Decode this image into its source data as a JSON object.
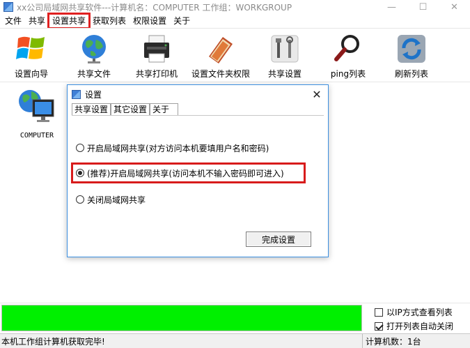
{
  "window": {
    "title": "xx公司局域网共享软件---计算机名：COMPUTER  工作组：WORKGROUP",
    "minimize": "—",
    "maximize": "☐",
    "close": "✕"
  },
  "menu": [
    {
      "label": "文件"
    },
    {
      "label": "共享"
    },
    {
      "label": "设置共享"
    },
    {
      "label": "获取列表"
    },
    {
      "label": "权限设置"
    },
    {
      "label": "关于"
    }
  ],
  "toolbar": [
    {
      "label": "设置向导",
      "icon": "windows-logo-icon"
    },
    {
      "label": "共享文件",
      "icon": "globe-icon"
    },
    {
      "label": "共享打印机",
      "icon": "printer-icon"
    },
    {
      "label": "设置文件夹权限",
      "icon": "folder-book-icon"
    },
    {
      "label": "共享设置",
      "icon": "tools-icon"
    },
    {
      "label": "ping列表",
      "icon": "magnifier-icon"
    },
    {
      "label": "刷新列表",
      "icon": "refresh-icon"
    }
  ],
  "computers": [
    {
      "name": "COMPUTER",
      "icon": "network-computer-icon"
    }
  ],
  "dialog": {
    "title": "设置",
    "close": "✕",
    "tabs": [
      {
        "label": "共享设置"
      },
      {
        "label": "其它设置"
      },
      {
        "label": "关于"
      }
    ],
    "options": [
      {
        "label": "开启局域网共享(对方访问本机要填用户名和密码)",
        "checked": false
      },
      {
        "label": "(推荐)开启局域网共享(访问本机不输入密码即可进入)",
        "checked": true
      },
      {
        "label": "关闭局域网共享",
        "checked": false
      }
    ],
    "finish_button": "完成设置"
  },
  "progress": {
    "percent": 100,
    "color": "#00f000"
  },
  "checkboxes": [
    {
      "label": "以IP方式查看列表",
      "checked": false
    },
    {
      "label": "打开列表自动关闭",
      "checked": true
    }
  ],
  "status": {
    "left": "本机工作组计算机获取完毕!",
    "right": "计算机数：1台"
  },
  "colors": {
    "highlight": "#d81b1b",
    "dialog_border": "#3c8fe0"
  }
}
